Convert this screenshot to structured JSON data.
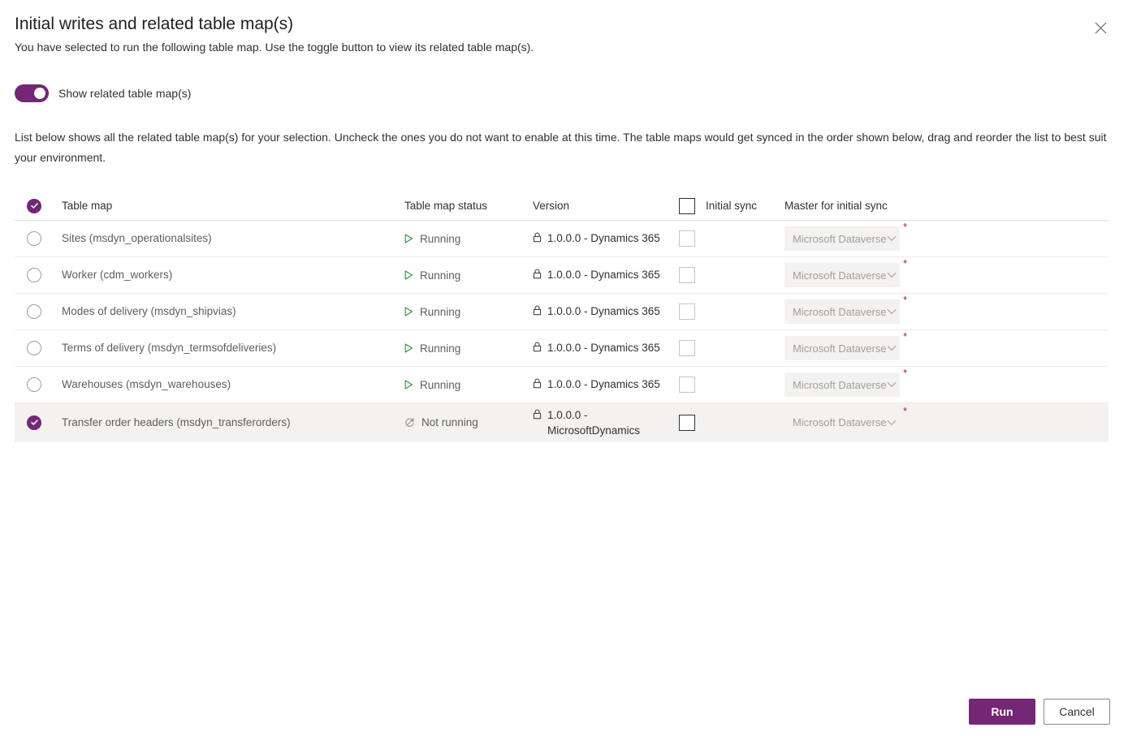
{
  "dialog": {
    "title": "Initial writes and related table map(s)",
    "subtitle": "You have selected to run the following table map. Use the toggle button to view its related table map(s).",
    "close_label": "Close",
    "description": "List below shows all the related table map(s) for your selection. Uncheck the ones you do not want to enable at this time. The table maps would get synced in the order shown below, drag and reorder the list to best suit your environment."
  },
  "toggle": {
    "label": "Show related table map(s)",
    "state": "on"
  },
  "table": {
    "columns": {
      "select": "",
      "name": "Table map",
      "status": "Table map status",
      "version": "Version",
      "initial_sync": "Initial sync",
      "master": "Master for initial sync"
    },
    "rows": [
      {
        "name": "Sites (msdyn_operationalsites)",
        "status": "Running",
        "status_icon": "play-icon",
        "version": "1.0.0.0 - Dynamics 365",
        "initial_sync_checked": false,
        "master": "Microsoft Dataverse",
        "required": "*",
        "selected": false
      },
      {
        "name": "Worker (cdm_workers)",
        "status": "Running",
        "status_icon": "play-icon",
        "version": "1.0.0.0 - Dynamics 365",
        "initial_sync_checked": false,
        "master": "Microsoft Dataverse",
        "required": "*",
        "selected": false
      },
      {
        "name": "Modes of delivery (msdyn_shipvias)",
        "status": "Running",
        "status_icon": "play-icon",
        "version": "1.0.0.0 - Dynamics 365",
        "initial_sync_checked": false,
        "master": "Microsoft Dataverse",
        "required": "*",
        "selected": false
      },
      {
        "name": "Terms of delivery (msdyn_termsofdeliveries)",
        "status": "Running",
        "status_icon": "play-icon",
        "version": "1.0.0.0 - Dynamics 365",
        "initial_sync_checked": false,
        "master": "Microsoft Dataverse",
        "required": "*",
        "selected": false
      },
      {
        "name": "Warehouses (msdyn_warehouses)",
        "status": "Running",
        "status_icon": "play-icon",
        "version": "1.0.0.0 - Dynamics 365",
        "initial_sync_checked": false,
        "master": "Microsoft Dataverse",
        "required": "*",
        "selected": false
      },
      {
        "name": "Transfer order headers (msdyn_transferorders)",
        "status": "Not running",
        "status_icon": "not-running-icon",
        "version": "1.0.0.0 - MicrosoftDynamics",
        "initial_sync_checked": false,
        "master": "Microsoft Dataverse",
        "required": "*",
        "selected": true
      }
    ]
  },
  "footer": {
    "run_label": "Run",
    "cancel_label": "Cancel"
  },
  "colors": {
    "accent_purple": "#742774",
    "running_green": "#2f8f3e",
    "required_red": "#a4262c",
    "row_highlight": "#f3f2f1"
  }
}
